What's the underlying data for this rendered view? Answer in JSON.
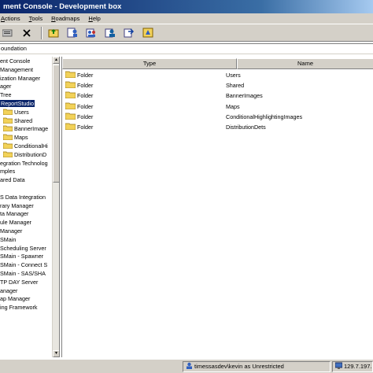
{
  "window": {
    "title": "ment Console - Development box"
  },
  "menu": [
    {
      "label": "Actions",
      "accel": "A",
      "rest": "ctions"
    },
    {
      "label": "Tools",
      "accel": "T",
      "rest": "ools"
    },
    {
      "label": "Roadmaps",
      "accel": "R",
      "rest": "oadmaps"
    },
    {
      "label": "Help",
      "accel": "H",
      "rest": "elp"
    }
  ],
  "toolbar": {
    "icons": [
      "properties-icon",
      "delete-icon",
      "folder-up-icon",
      "user-icon",
      "group-icon",
      "role-icon",
      "connect-icon",
      "refresh-icon"
    ]
  },
  "address": {
    "value": "oundation"
  },
  "tree": {
    "items": [
      {
        "label": "ent Console",
        "indent": 0,
        "folder": false,
        "selected": false
      },
      {
        "label": "Management",
        "indent": 0,
        "folder": false,
        "selected": false
      },
      {
        "label": "ization Manager",
        "indent": 0,
        "folder": false,
        "selected": false
      },
      {
        "label": "ager",
        "indent": 0,
        "folder": false,
        "selected": false
      },
      {
        "label": "Tree",
        "indent": 1,
        "folder": false,
        "selected": false
      },
      {
        "label": "ReportStudio",
        "indent": 1,
        "folder": false,
        "selected": true
      },
      {
        "label": "Users",
        "indent": 2,
        "folder": true,
        "selected": false
      },
      {
        "label": "Shared",
        "indent": 2,
        "folder": true,
        "selected": false
      },
      {
        "label": "BannerImage",
        "indent": 2,
        "folder": true,
        "selected": false
      },
      {
        "label": "Maps",
        "indent": 2,
        "folder": true,
        "selected": false
      },
      {
        "label": "ConditionalHi",
        "indent": 2,
        "folder": true,
        "selected": false
      },
      {
        "label": "DistributionD",
        "indent": 2,
        "folder": true,
        "selected": false
      },
      {
        "label": "egration Technolog",
        "indent": 0,
        "folder": false,
        "selected": false
      },
      {
        "label": "mples",
        "indent": 0,
        "folder": false,
        "selected": false
      },
      {
        "label": "ared Data",
        "indent": 0,
        "folder": false,
        "selected": false
      },
      {
        "label": "",
        "indent": 0,
        "folder": false,
        "selected": false
      },
      {
        "label": "S Data Integration",
        "indent": 0,
        "folder": false,
        "selected": false
      },
      {
        "label": "rary Manager",
        "indent": 0,
        "folder": false,
        "selected": false
      },
      {
        "label": "ta Manager",
        "indent": 0,
        "folder": false,
        "selected": false
      },
      {
        "label": "ule Manager",
        "indent": 0,
        "folder": false,
        "selected": false
      },
      {
        "label": "Manager",
        "indent": 0,
        "folder": false,
        "selected": false
      },
      {
        "label": "SMain",
        "indent": 0,
        "folder": false,
        "selected": false
      },
      {
        "label": "Scheduling Server",
        "indent": 0,
        "folder": false,
        "selected": false
      },
      {
        "label": "SMain - Spawner",
        "indent": 0,
        "folder": false,
        "selected": false
      },
      {
        "label": "SMain - Connect S",
        "indent": 0,
        "folder": false,
        "selected": false
      },
      {
        "label": "SMain - SAS/SHA",
        "indent": 0,
        "folder": false,
        "selected": false
      },
      {
        "label": "TP DAY Server",
        "indent": 0,
        "folder": false,
        "selected": false
      },
      {
        "label": "anager",
        "indent": 0,
        "folder": false,
        "selected": false
      },
      {
        "label": "ap Manager",
        "indent": 0,
        "folder": false,
        "selected": false
      },
      {
        "label": "ing Framework",
        "indent": 0,
        "folder": false,
        "selected": false
      }
    ]
  },
  "list": {
    "columns": [
      "Type",
      "Name"
    ],
    "rows": [
      {
        "type": "Folder",
        "name": "Users"
      },
      {
        "type": "Folder",
        "name": "Shared"
      },
      {
        "type": "Folder",
        "name": "BannerImages"
      },
      {
        "type": "Folder",
        "name": "Maps"
      },
      {
        "type": "Folder",
        "name": "ConditionalHighlightingImages"
      },
      {
        "type": "Folder",
        "name": "DistributionDets"
      }
    ]
  },
  "status": {
    "user": "timessasdev\\kevin as Unrestricted",
    "host": "129.7.197.",
    "icon": "user-status-icon",
    "host_icon": "network-icon"
  },
  "colors": {
    "title_bar": "#0a246a",
    "chrome": "#d4d0c8",
    "selection": "#0a246a",
    "folder": "#f2d25a"
  }
}
